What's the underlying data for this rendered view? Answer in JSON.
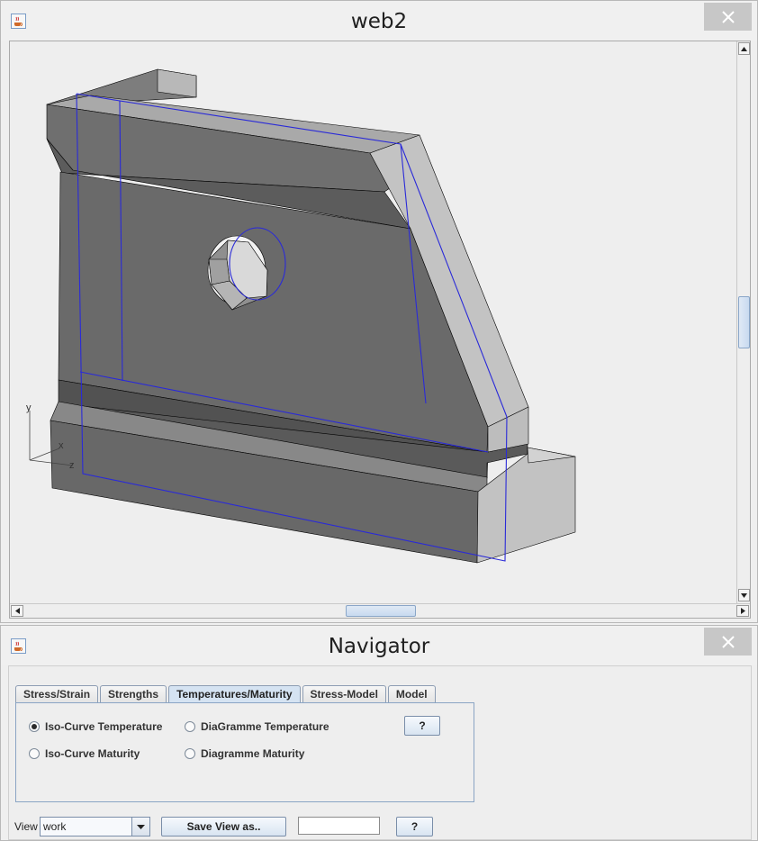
{
  "viewer_window": {
    "title": "web2",
    "icon": "java-cup-icon",
    "close_icon": "close-x-icon",
    "axis_labels": {
      "y": "y",
      "x": "x",
      "z": "z"
    },
    "colors": {
      "outline": "#2a2ad8",
      "face_dark": "#6a6a6a",
      "face_light": "#c2c2c2"
    }
  },
  "navigator_window": {
    "title": "Navigator",
    "icon": "java-cup-icon",
    "close_icon": "close-x-icon",
    "tabs": [
      {
        "label": "Stress/Strain",
        "active": false
      },
      {
        "label": "Strengths",
        "active": false
      },
      {
        "label": "Temperatures/Maturity",
        "active": true
      },
      {
        "label": "Stress-Model",
        "active": false
      },
      {
        "label": "Model",
        "active": false
      }
    ],
    "options": [
      {
        "label": "Iso-Curve Temperature",
        "selected": true
      },
      {
        "label": "DiaGramme Temperature",
        "selected": false
      },
      {
        "label": "Iso-Curve Maturity",
        "selected": false
      },
      {
        "label": "Diagramme Maturity",
        "selected": false
      }
    ],
    "help_label": "?",
    "view": {
      "label": "View",
      "selected": "work",
      "save_label": "Save View as..",
      "name_value": "",
      "help_label": "?"
    }
  }
}
